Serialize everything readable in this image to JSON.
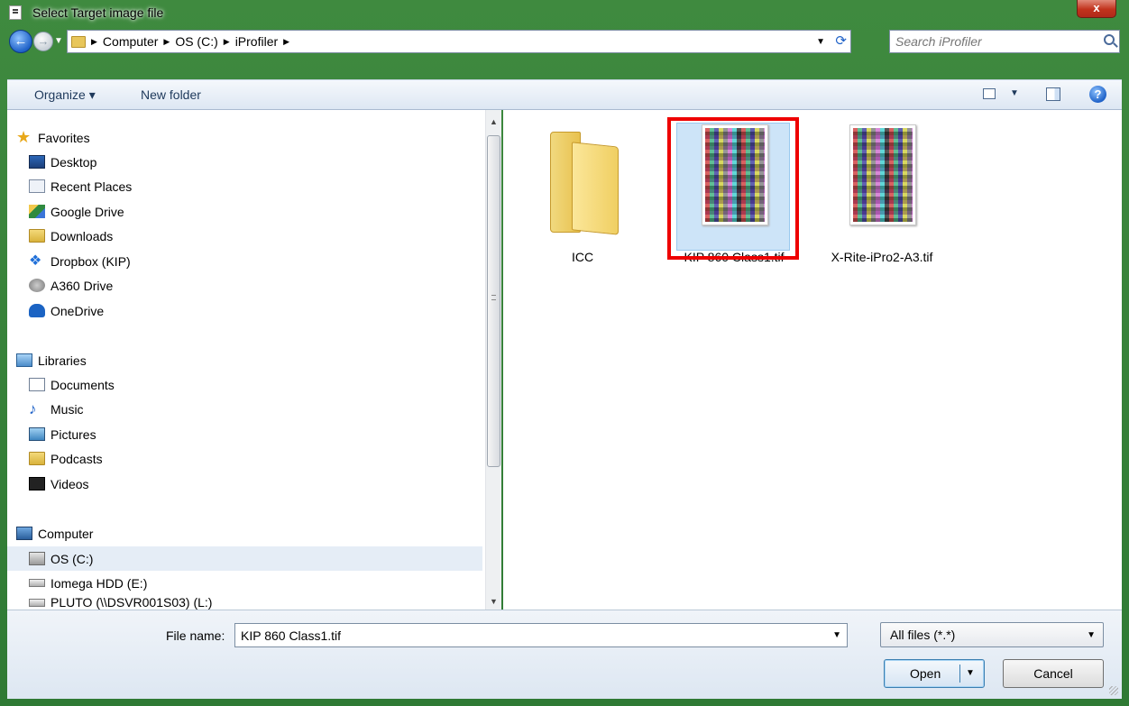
{
  "window": {
    "title": "Select Target image file",
    "close_label": "x"
  },
  "address": {
    "back_label": "←",
    "forward_label": "→",
    "breadcrumb": [
      "Computer",
      "OS (C:)",
      "iProfiler"
    ],
    "refresh_label": "⟳",
    "search_placeholder": "Search iProfiler"
  },
  "toolbar": {
    "organize_label": "Organize ▾",
    "new_folder_label": "New folder",
    "help_label": "?"
  },
  "nav": {
    "items": [
      {
        "label": "Favorites",
        "icon": "star-icon"
      },
      {
        "label": "Desktop",
        "icon": "desktop-icon"
      },
      {
        "label": "Recent Places",
        "icon": "recent-places-icon"
      },
      {
        "label": "Google Drive",
        "icon": "google-drive-icon"
      },
      {
        "label": "Downloads",
        "icon": "downloads-folder-icon"
      },
      {
        "label": "Dropbox (KIP)",
        "icon": "dropbox-icon"
      },
      {
        "label": "A360 Drive",
        "icon": "a360-drive-icon"
      },
      {
        "label": "OneDrive",
        "icon": "onedrive-icon"
      },
      {
        "label": "Libraries",
        "icon": "libraries-icon"
      },
      {
        "label": "Documents",
        "icon": "documents-icon"
      },
      {
        "label": "Music",
        "icon": "music-icon"
      },
      {
        "label": "Pictures",
        "icon": "pictures-icon"
      },
      {
        "label": "Podcasts",
        "icon": "podcasts-folder-icon"
      },
      {
        "label": "Videos",
        "icon": "videos-icon"
      },
      {
        "label": "Computer",
        "icon": "computer-icon"
      },
      {
        "label": "OS (C:)",
        "icon": "drive-c-icon"
      },
      {
        "label": "Iomega HDD (E:)",
        "icon": "drive-icon"
      },
      {
        "label": "PLUTO (\\\\DSVR001S03) (L:)",
        "icon": "network-drive-icon"
      }
    ],
    "selected": "OS (C:)"
  },
  "files": [
    {
      "name": "ICC",
      "type": "folder"
    },
    {
      "name": "KIP 860 Class1.tif",
      "type": "tif",
      "selected": true
    },
    {
      "name": "X-Rite-iPro2-A3.tif",
      "type": "tif"
    }
  ],
  "footer": {
    "file_name_label": "File name:",
    "file_name_value": "KIP 860 Class1.tif",
    "filter_value": "All files (*.*)",
    "open_label": "Open",
    "cancel_label": "Cancel"
  },
  "colors": {
    "highlight": "#e00000",
    "selection": "#cde4f8"
  }
}
